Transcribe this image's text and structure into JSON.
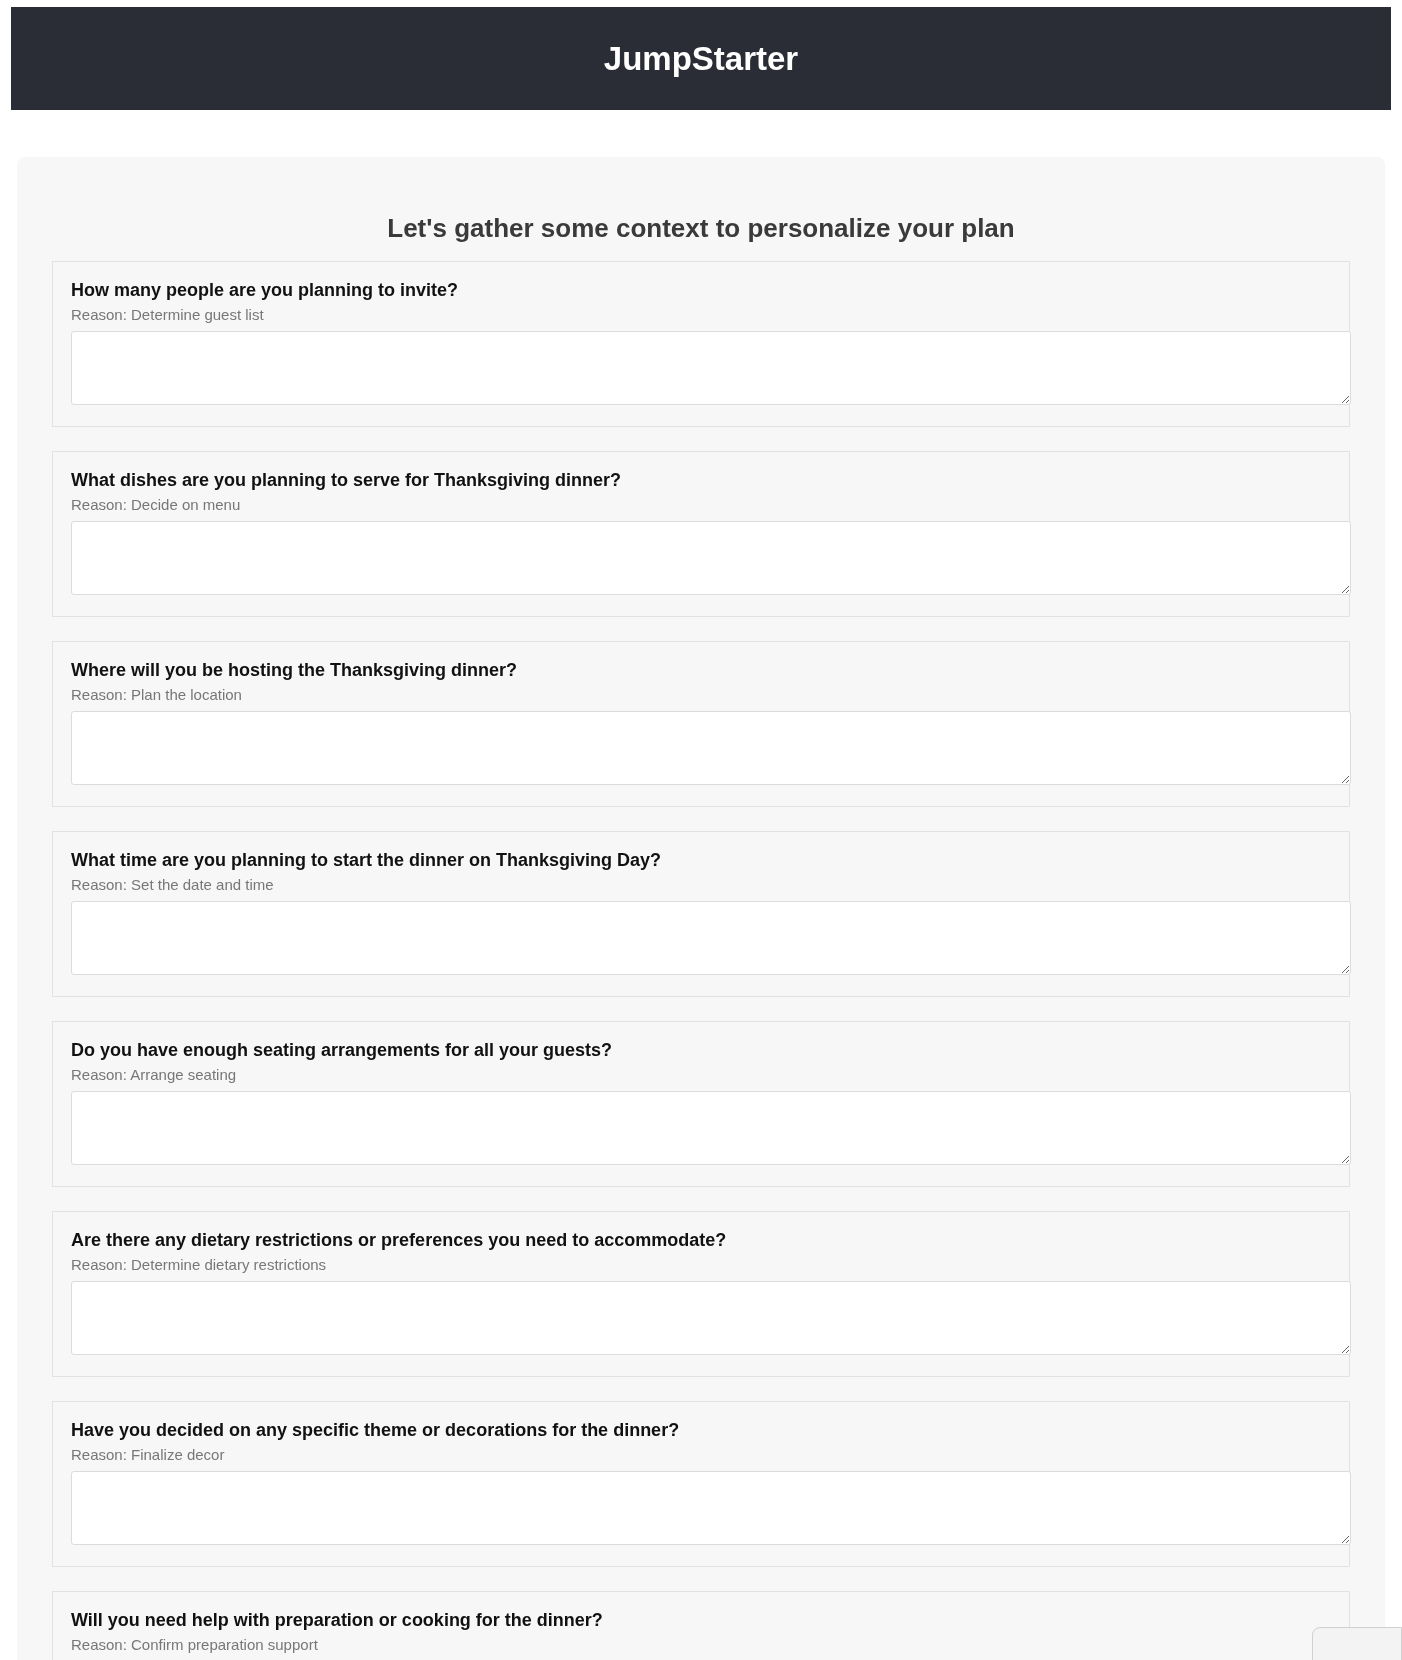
{
  "header": {
    "title": "JumpStarter"
  },
  "form": {
    "heading": "Let's gather some context to personalize your plan",
    "questions": [
      {
        "question": "How many people are you planning to invite?",
        "reason": "Reason: Determine guest list"
      },
      {
        "question": "What dishes are you planning to serve for Thanksgiving dinner?",
        "reason": "Reason: Decide on menu"
      },
      {
        "question": "Where will you be hosting the Thanksgiving dinner?",
        "reason": "Reason: Plan the location"
      },
      {
        "question": "What time are you planning to start the dinner on Thanksgiving Day?",
        "reason": "Reason: Set the date and time"
      },
      {
        "question": "Do you have enough seating arrangements for all your guests?",
        "reason": "Reason: Arrange seating"
      },
      {
        "question": "Are there any dietary restrictions or preferences you need to accommodate?",
        "reason": "Reason: Determine dietary restrictions"
      },
      {
        "question": "Have you decided on any specific theme or decorations for the dinner?",
        "reason": "Reason: Finalize decor"
      },
      {
        "question": "Will you need help with preparation or cooking for the dinner?",
        "reason": "Reason: Confirm preparation support"
      }
    ]
  }
}
